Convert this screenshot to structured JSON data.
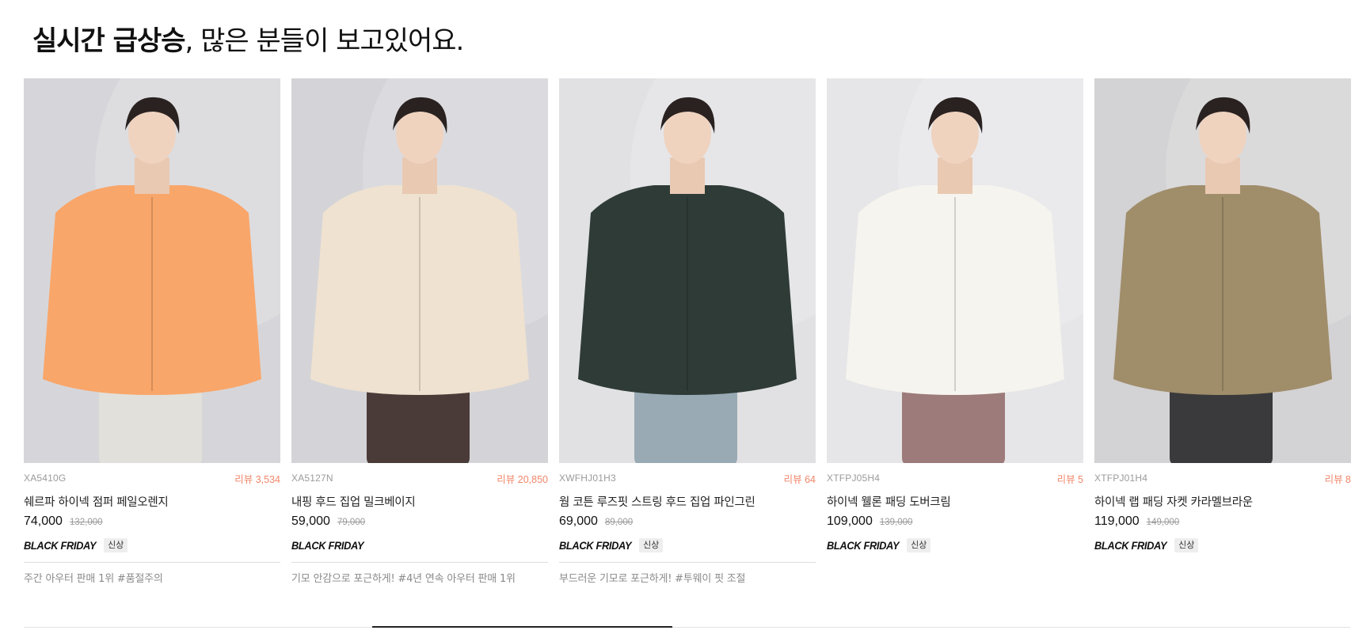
{
  "section": {
    "title_strong": "실시간 급상승",
    "title_rest": ", 많은 분들이 보고있어요."
  },
  "products": [
    {
      "code": "XA5410G",
      "review": "리뷰 3,534",
      "name": "쉐르파 하이넥 점퍼 페일오렌지",
      "price": "74,000",
      "original_price": "132,000",
      "promo": "BLACK FRIDAY",
      "badge": "신상",
      "description": "주간 아우터 판매 1위 #품절주의",
      "bg_color": "#d6d6da",
      "garment_color": "#f9a66a",
      "pants_color": "#e2e0da"
    },
    {
      "code": "XA5127N",
      "review": "리뷰 20,850",
      "name": "내핑 후드 집업 밀크베이지",
      "price": "59,000",
      "original_price": "79,000",
      "promo": "BLACK FRIDAY",
      "badge": "",
      "description": "기모 안감으로 포근하게! #4년 연속 아우터 판매 1위",
      "bg_color": "#d4d4d8",
      "garment_color": "#efe2d0",
      "pants_color": "#4a3b38"
    },
    {
      "code": "XWFHJ01H3",
      "review": "리뷰 64",
      "name": "웜 코튼 루즈핏 스트링 후드 집업 파인그린",
      "price": "69,000",
      "original_price": "89,000",
      "promo": "BLACK FRIDAY",
      "badge": "신상",
      "description": "부드러운 기모로 포근하게! #투웨이 핏 조절",
      "bg_color": "#e1e1e3",
      "garment_color": "#2f3b37",
      "pants_color": "#9aaab4"
    },
    {
      "code": "XTFPJ05H4",
      "review": "리뷰 5",
      "name": "하이넥 웰론 패딩 도버크림",
      "price": "109,000",
      "original_price": "139,000",
      "promo": "BLACK FRIDAY",
      "badge": "신상",
      "description": "",
      "bg_color": "#e6e6e8",
      "garment_color": "#f6f4ee",
      "pants_color": "#9c7b7a"
    },
    {
      "code": "XTFPJ01H4",
      "review": "리뷰 8",
      "name": "하이넥 랩 패딩 자켓 카라멜브라운",
      "price": "119,000",
      "original_price": "149,000",
      "promo": "BLACK FRIDAY",
      "badge": "신상",
      "description": "",
      "bg_color": "#d3d2d4",
      "garment_color": "#a08d6a",
      "pants_color": "#3a3a3c"
    }
  ],
  "colors": {
    "review_accent": "#f0876a",
    "muted_text": "#9a9a9a"
  }
}
